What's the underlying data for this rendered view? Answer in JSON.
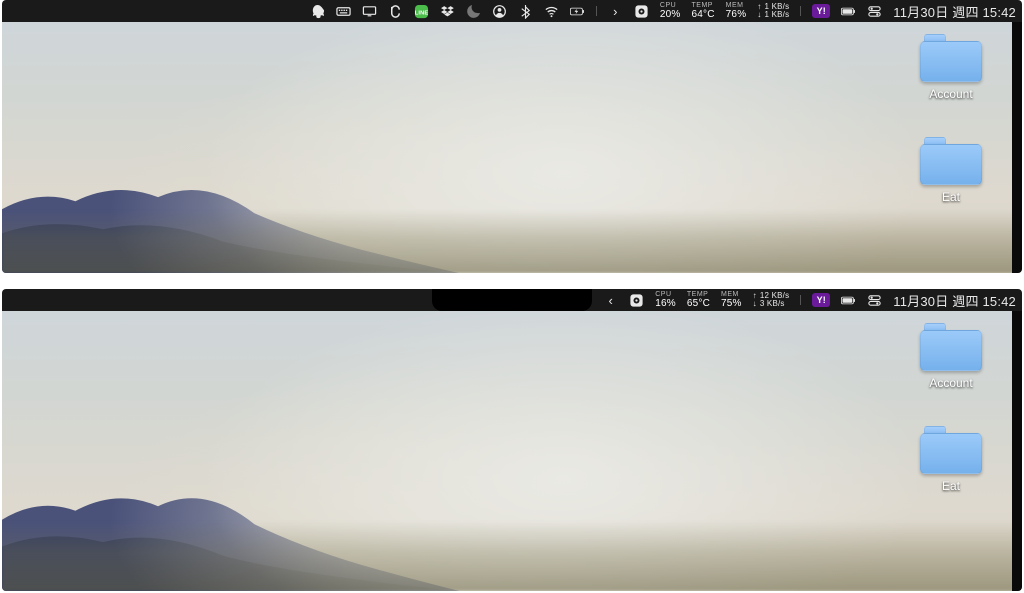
{
  "screenshots": [
    {
      "menubar": {
        "expanded": true,
        "chevron": "›",
        "stats": {
          "cpu_label": "CPU",
          "cpu_value": "20%",
          "temp_label": "TEMP",
          "temp_value": "64°C",
          "mem_label": "MEM",
          "mem_value": "76%",
          "net_up": "1 KB/s",
          "net_down": "1 KB/s"
        },
        "yahoo_label": "Y!",
        "datetime": "11月30日 週四 15:42"
      },
      "folders": [
        {
          "name": "Account"
        },
        {
          "name": "Eat"
        }
      ]
    },
    {
      "menubar": {
        "expanded": false,
        "chevron": "‹",
        "stats": {
          "cpu_label": "CPU",
          "cpu_value": "16%",
          "temp_label": "TEMP",
          "temp_value": "65°C",
          "mem_label": "MEM",
          "mem_value": "75%",
          "net_up": "12 KB/s",
          "net_down": "3 KB/s"
        },
        "yahoo_label": "Y!",
        "datetime": "11月30日 週四 15:42"
      },
      "folders": [
        {
          "name": "Account"
        },
        {
          "name": "Eat"
        }
      ]
    }
  ]
}
